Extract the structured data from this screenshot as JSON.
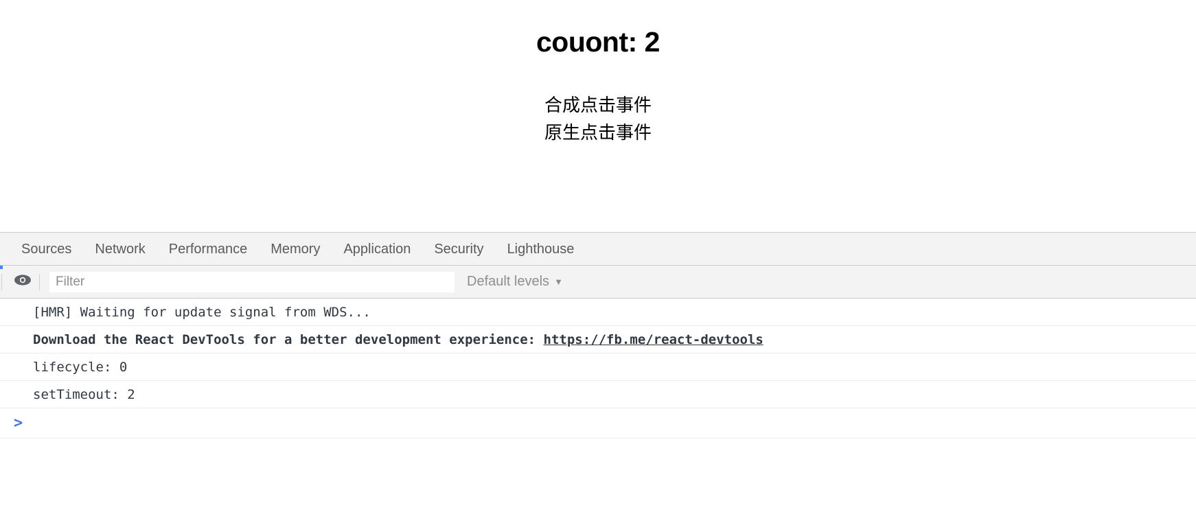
{
  "page": {
    "heading": "couont: 2",
    "lines": [
      "合成点击事件",
      "原生点击事件"
    ]
  },
  "devtools": {
    "tabs": [
      {
        "label": "Sources"
      },
      {
        "label": "Network"
      },
      {
        "label": "Performance"
      },
      {
        "label": "Memory"
      },
      {
        "label": "Application"
      },
      {
        "label": "Security"
      },
      {
        "label": "Lighthouse"
      }
    ],
    "toolbar": {
      "eye_icon": "eye-icon",
      "filter_value": "",
      "filter_placeholder": "Filter",
      "levels_label": "Default levels",
      "levels_caret": "▼",
      "accent_color": "#4285f4"
    },
    "console": {
      "messages": [
        {
          "text": "[HMR] Waiting for update signal from WDS...",
          "bold": false,
          "link": ""
        },
        {
          "text": "Download the React DevTools for a better development experience: ",
          "bold": true,
          "link": "https://fb.me/react-devtools"
        },
        {
          "text": "lifecycle: 0",
          "bold": false,
          "link": ""
        },
        {
          "text": "setTimeout: 2",
          "bold": false,
          "link": ""
        }
      ],
      "prompt": ">"
    }
  }
}
